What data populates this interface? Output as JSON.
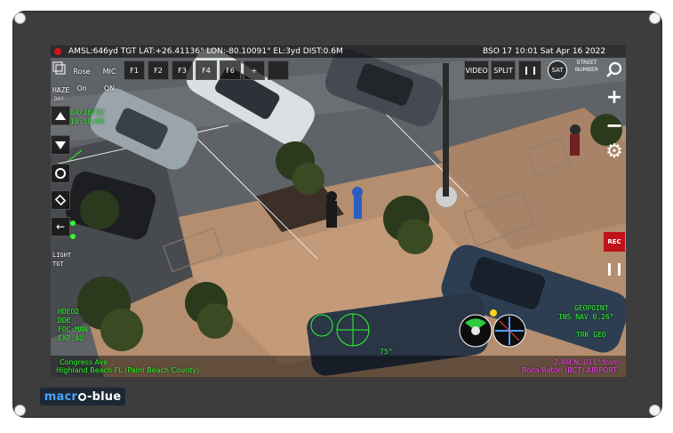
{
  "topbar": {
    "telemetry": "AMSL:646yd TGT LAT:+26.41136° LON:-80.10091° EL:3yd DIST:0.6M",
    "datetime": "BSO 17 10:01 Sat Apr 16 2022"
  },
  "controls": {
    "rose_label": "Rose",
    "rose_state": "On",
    "mic_label": "MIC",
    "mic_state": "ON",
    "f1": "F1",
    "f2": "F2",
    "f3": "F3",
    "f4": "F4",
    "f6": "F6",
    "plus": "+",
    "video": "VIDEO",
    "split": "SPLIT",
    "sat": "SAT",
    "street_label": "STREET",
    "street_sub": "NUMBER",
    "rec": "REC"
  },
  "left_hud": {
    "haze": "HAZE",
    "day": "DAY",
    "date": "04/16/22",
    "time": "10:10:01",
    "light": "LIGHT",
    "tgt": "TGT",
    "lines": [
      "HDEO2",
      "DDE",
      "FOC:MAN",
      "EXP:AU"
    ]
  },
  "right_hud": {
    "geopoint": "GEOPOINT",
    "ins_nav": "INS NAV 0.26°",
    "trk": "TRK GEO"
  },
  "bottom": {
    "street": "Congress Ave",
    "locality": "Highland Beach FL (Palm Beach County)",
    "distance": "2.4M N, 011° from",
    "airport": "Boca Raton (BCT) AIRPORT"
  },
  "compass_heading": "75°",
  "brand": {
    "part1": "macr",
    "part2": "-blue",
    "accent": "#4aa3ff"
  },
  "colors": {
    "hud_green": "#2aff2a",
    "rec_red": "#c0121a",
    "magenta": "#ff40ff"
  }
}
